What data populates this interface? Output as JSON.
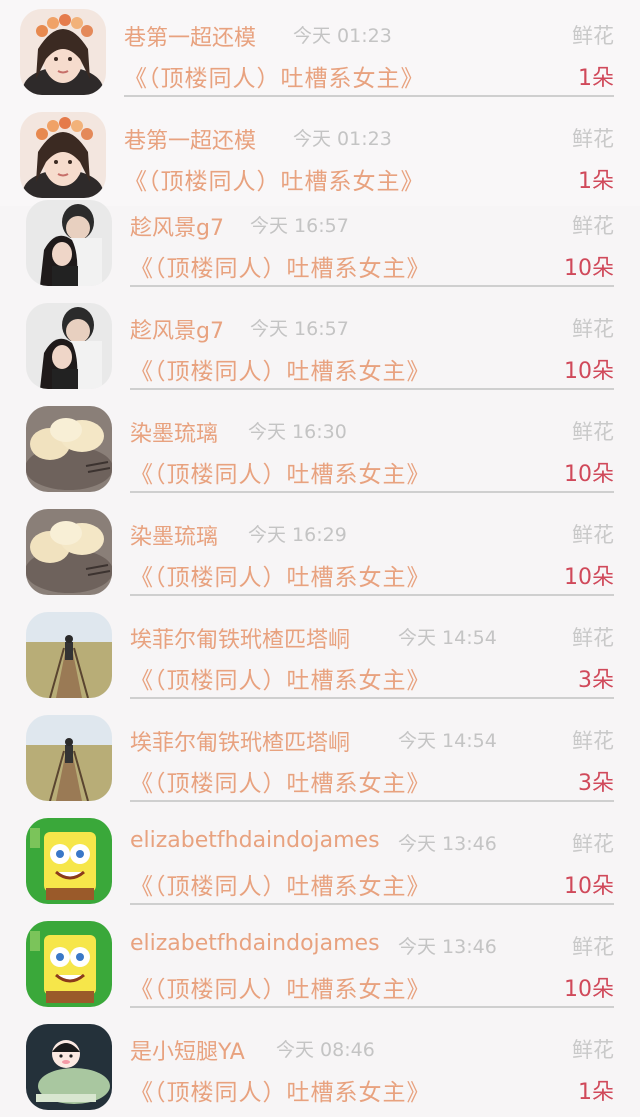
{
  "rows": [
    {
      "name": "巷第一超还模",
      "time": "今天 01:23",
      "gift": "鲜花",
      "book": "《（顶楼同人）吐槽系女主》",
      "count": "1朵",
      "avatar": "girl-flower-crown"
    },
    {
      "name": "巷第一超还模",
      "time": "今天 01:23",
      "gift": "鲜花",
      "book": "《（顶楼同人）吐槽系女主》",
      "count": "1朵",
      "avatar": "girl-flower-crown"
    },
    {
      "name": "趁风景g7",
      "time": "今天 16:57",
      "gift": "鲜花",
      "book": "《（顶楼同人）吐槽系女主》",
      "count": "10朵",
      "avatar": "couple-photo"
    },
    {
      "name": "趁风景g7",
      "time": "今天 16:57",
      "gift": "鲜花",
      "book": "《（顶楼同人）吐槽系女主》",
      "count": "10朵",
      "avatar": "couple-photo"
    },
    {
      "name": "染墨琉璃",
      "time": "今天 16:30",
      "gift": "鲜花",
      "book": "《（顶楼同人）吐槽系女主》",
      "count": "10朵",
      "avatar": "dumplings-plate"
    },
    {
      "name": "染墨琉璃",
      "time": "今天 16:29",
      "gift": "鲜花",
      "book": "《（顶楼同人）吐槽系女主》",
      "count": "10朵",
      "avatar": "dumplings-plate"
    },
    {
      "name": "埃菲尔匍铁玳楂匹塔峒",
      "time": "今天 14:54",
      "gift": "鲜花",
      "book": "《（顶楼同人）吐槽系女主》",
      "count": "3朵",
      "avatar": "boardwalk-cyclist"
    },
    {
      "name": "埃菲尔匍铁玳楂匹塔峒",
      "time": "今天 14:54",
      "gift": "鲜花",
      "book": "《（顶楼同人）吐槽系女主》",
      "count": "3朵",
      "avatar": "boardwalk-cyclist"
    },
    {
      "name": "elizabetfhdaindojames",
      "time": "今天 13:46",
      "gift": "鲜花",
      "book": "《（顶楼同人）吐槽系女主》",
      "count": "10朵",
      "avatar": "spongebob"
    },
    {
      "name": "elizabetfhdaindojames",
      "time": "今天 13:46",
      "gift": "鲜花",
      "book": "《（顶楼同人）吐槽系女主》",
      "count": "10朵",
      "avatar": "spongebob"
    },
    {
      "name": "是小短腿YA",
      "time": "今天 08:46",
      "gift": "鲜花",
      "book": "《（顶楼同人）吐槽系女主》",
      "count": "1朵",
      "avatar": "cartoon-girl-lying"
    }
  ]
}
